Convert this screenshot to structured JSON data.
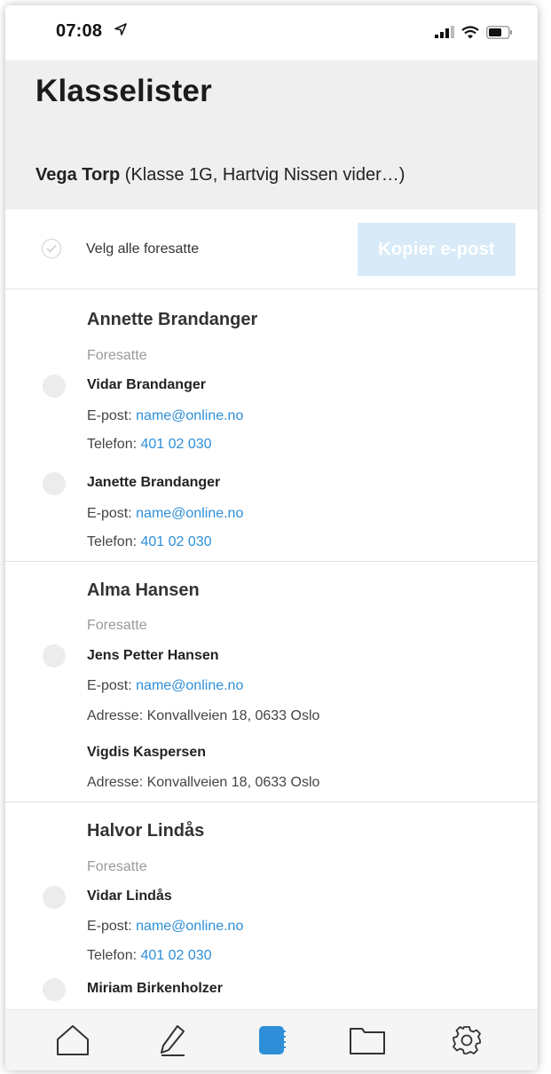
{
  "status_bar": {
    "time": "07:08"
  },
  "header": {
    "title": "Klasselister",
    "context_name": "Vega Torp",
    "context_detail": "(Klasse 1G, Hartvig Nissen vider…)"
  },
  "select_all": {
    "label": "Velg alle foresatte",
    "copy_button": "Kopier e-post"
  },
  "labels": {
    "guardians": "Foresatte",
    "email": "E-post:",
    "phone": "Telefon:",
    "address": "Adresse:"
  },
  "students": [
    {
      "name": "Annette Brandanger",
      "guardians": [
        {
          "name": "Vidar Brandanger",
          "email": "name@online.no",
          "phone": "401 02 030"
        },
        {
          "name": "Janette Brandanger",
          "email": "name@online.no",
          "phone": "401 02 030"
        }
      ]
    },
    {
      "name": "Alma Hansen",
      "guardians": [
        {
          "name": "Jens Petter Hansen",
          "email": "name@online.no",
          "address": "Konvallveien 18, 0633 Oslo"
        },
        {
          "name": "Vigdis Kaspersen",
          "address": "Konvallveien 18, 0633 Oslo"
        }
      ]
    },
    {
      "name": "Halvor Lindås",
      "guardians": [
        {
          "name": "Vidar Lindås",
          "email": "name@online.no",
          "phone": "401 02 030"
        },
        {
          "name": "Miriam Birkenholzer"
        }
      ]
    }
  ],
  "tab_bar": {
    "tabs": [
      {
        "icon": "home-icon"
      },
      {
        "icon": "pencil-icon"
      },
      {
        "icon": "class-list-icon",
        "active": true
      },
      {
        "icon": "folder-icon"
      },
      {
        "icon": "settings-gear-icon"
      }
    ],
    "active_color": "#2e8fd8"
  },
  "colors": {
    "accent": "#2e8fd8",
    "button_disabled": "#d8eaf7",
    "header_bg": "#efefef"
  }
}
